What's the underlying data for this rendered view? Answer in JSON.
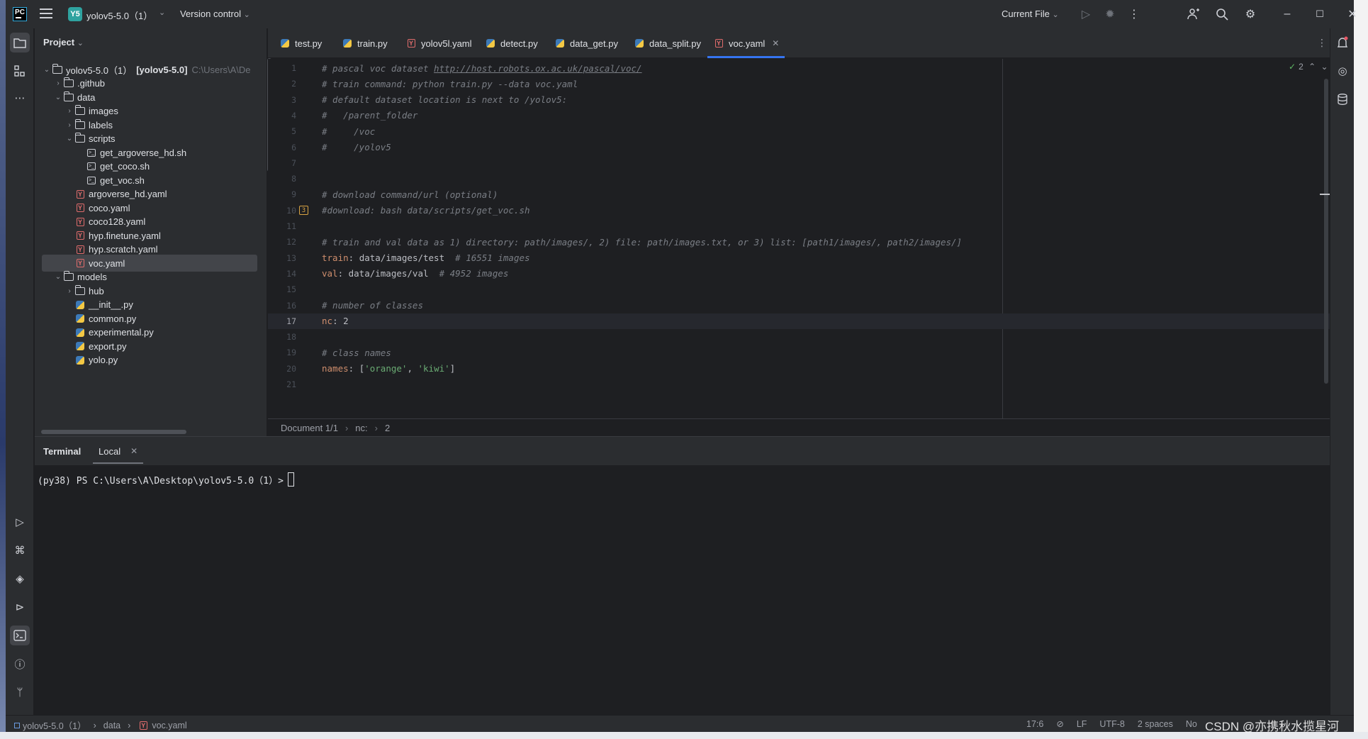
{
  "titlebar": {
    "app_logo": "PC",
    "project_badge": "Y5",
    "project_name": "yolov5-5.0（1）",
    "vcs_label": "Version control",
    "run_config": "Current File",
    "icons": [
      "hamburger-icon",
      "run-icon",
      "debug-icon",
      "more-icon",
      "add-user-icon",
      "search-icon",
      "settings-icon",
      "minimize-icon",
      "maximize-icon",
      "close-icon"
    ]
  },
  "project_panel": {
    "header": "Project",
    "root": {
      "name": "yolov5-5.0（1）",
      "module": "[yolov5-5.0]",
      "path": "C:\\Users\\A\\De"
    },
    "tree": [
      {
        "label": ".github",
        "type": "folder",
        "depth": 1,
        "expanded": false
      },
      {
        "label": "data",
        "type": "folder",
        "depth": 1,
        "expanded": true
      },
      {
        "label": "images",
        "type": "folder",
        "depth": 2,
        "expanded": false
      },
      {
        "label": "labels",
        "type": "folder",
        "depth": 2,
        "expanded": false
      },
      {
        "label": "scripts",
        "type": "folder",
        "depth": 2,
        "expanded": true
      },
      {
        "label": "get_argoverse_hd.sh",
        "type": "sh",
        "depth": 3
      },
      {
        "label": "get_coco.sh",
        "type": "sh",
        "depth": 3
      },
      {
        "label": "get_voc.sh",
        "type": "sh",
        "depth": 3
      },
      {
        "label": "argoverse_hd.yaml",
        "type": "yaml",
        "depth": 2
      },
      {
        "label": "coco.yaml",
        "type": "yaml",
        "depth": 2
      },
      {
        "label": "coco128.yaml",
        "type": "yaml",
        "depth": 2
      },
      {
        "label": "hyp.finetune.yaml",
        "type": "yaml",
        "depth": 2
      },
      {
        "label": "hyp.scratch.yaml",
        "type": "yaml",
        "depth": 2
      },
      {
        "label": "voc.yaml",
        "type": "yaml",
        "depth": 2,
        "selected": true
      },
      {
        "label": "models",
        "type": "folder",
        "depth": 1,
        "expanded": true
      },
      {
        "label": "hub",
        "type": "folder",
        "depth": 2,
        "expanded": false
      },
      {
        "label": "__init__.py",
        "type": "py",
        "depth": 2
      },
      {
        "label": "common.py",
        "type": "py",
        "depth": 2
      },
      {
        "label": "experimental.py",
        "type": "py",
        "depth": 2
      },
      {
        "label": "export.py",
        "type": "py",
        "depth": 2
      },
      {
        "label": "yolo.py",
        "type": "py",
        "depth": 2
      }
    ]
  },
  "tabs": [
    {
      "label": "test.py",
      "type": "py"
    },
    {
      "label": "train.py",
      "type": "py"
    },
    {
      "label": "yolov5l.yaml",
      "type": "yaml"
    },
    {
      "label": "detect.py",
      "type": "py"
    },
    {
      "label": "data_get.py",
      "type": "py"
    },
    {
      "label": "data_split.py",
      "type": "py"
    },
    {
      "label": "voc.yaml",
      "type": "yaml",
      "active": true
    }
  ],
  "editor": {
    "inspection_count": "2",
    "fold_badge": "3",
    "current_line": 17,
    "lines": [
      {
        "n": "1",
        "parts": [
          [
            "c-com",
            "# pascal voc dataset "
          ],
          [
            "c-link",
            "http://host.robots.ox.ac.uk/pascal/voc/"
          ]
        ]
      },
      {
        "n": "2",
        "parts": [
          [
            "c-com",
            "# train command: python train.py --data voc.yaml"
          ]
        ]
      },
      {
        "n": "3",
        "parts": [
          [
            "c-com",
            "# default dataset location is next to /yolov5:"
          ]
        ]
      },
      {
        "n": "4",
        "parts": [
          [
            "c-com",
            "#   /parent_folder"
          ]
        ]
      },
      {
        "n": "5",
        "parts": [
          [
            "c-com",
            "#     /voc"
          ]
        ]
      },
      {
        "n": "6",
        "parts": [
          [
            "c-com",
            "#     /yolov5"
          ]
        ]
      },
      {
        "n": "7",
        "parts": []
      },
      {
        "n": "8",
        "parts": []
      },
      {
        "n": "9",
        "parts": [
          [
            "c-com",
            "# download command/url (optional)"
          ]
        ]
      },
      {
        "n": "10",
        "parts": [
          [
            "c-com",
            "#download: bash data/scripts/get_voc.sh"
          ]
        ]
      },
      {
        "n": "11",
        "parts": []
      },
      {
        "n": "12",
        "parts": [
          [
            "c-com",
            "# train and val data as 1) directory: path/images/, 2) file: path/images.txt, or 3) list: [path1/images/, path2/images/]"
          ]
        ]
      },
      {
        "n": "13",
        "parts": [
          [
            "c-key",
            "train"
          ],
          [
            "c-val",
            ": data/images/test  "
          ],
          [
            "c-com",
            "# 16551 images"
          ]
        ]
      },
      {
        "n": "14",
        "parts": [
          [
            "c-key",
            "val"
          ],
          [
            "c-val",
            ": data/images/val  "
          ],
          [
            "c-com",
            "# 4952 images"
          ]
        ]
      },
      {
        "n": "15",
        "parts": []
      },
      {
        "n": "16",
        "parts": [
          [
            "c-com",
            "# number of classes"
          ]
        ]
      },
      {
        "n": "17",
        "parts": [
          [
            "c-key",
            "nc"
          ],
          [
            "c-val",
            ": 2"
          ]
        ]
      },
      {
        "n": "18",
        "parts": []
      },
      {
        "n": "19",
        "parts": [
          [
            "c-com",
            "# class names"
          ]
        ]
      },
      {
        "n": "20",
        "parts": [
          [
            "c-key",
            "names"
          ],
          [
            "c-val",
            ": ["
          ],
          [
            "c-str",
            "'orange'"
          ],
          [
            "c-val",
            ", "
          ],
          [
            "c-str",
            "'kiwi'"
          ],
          [
            "c-val",
            "]"
          ]
        ]
      },
      {
        "n": "21",
        "parts": []
      }
    ]
  },
  "breadcrumb": [
    "Document 1/1",
    "nc:",
    "2"
  ],
  "terminal": {
    "title": "Terminal",
    "tab_label": "Local",
    "prompt": "(py38) PS C:\\Users\\A\\Desktop\\yolov5-5.0（1）>"
  },
  "statusbar": {
    "path": [
      "yolov5-5.0（1）",
      "data",
      "voc.yaml"
    ],
    "position": "17:6",
    "line_ending": "LF",
    "encoding": "UTF-8",
    "indent": "2 spaces",
    "extra": "No"
  },
  "watermark": "CSDN @亦携秋水揽星河",
  "colors": {
    "accent": "#3574f0",
    "panel_bg": "#2b2d30",
    "editor_bg": "#1e1f22",
    "comment": "#7a7e85",
    "key": "#cf8e6d",
    "string": "#6aab73"
  }
}
